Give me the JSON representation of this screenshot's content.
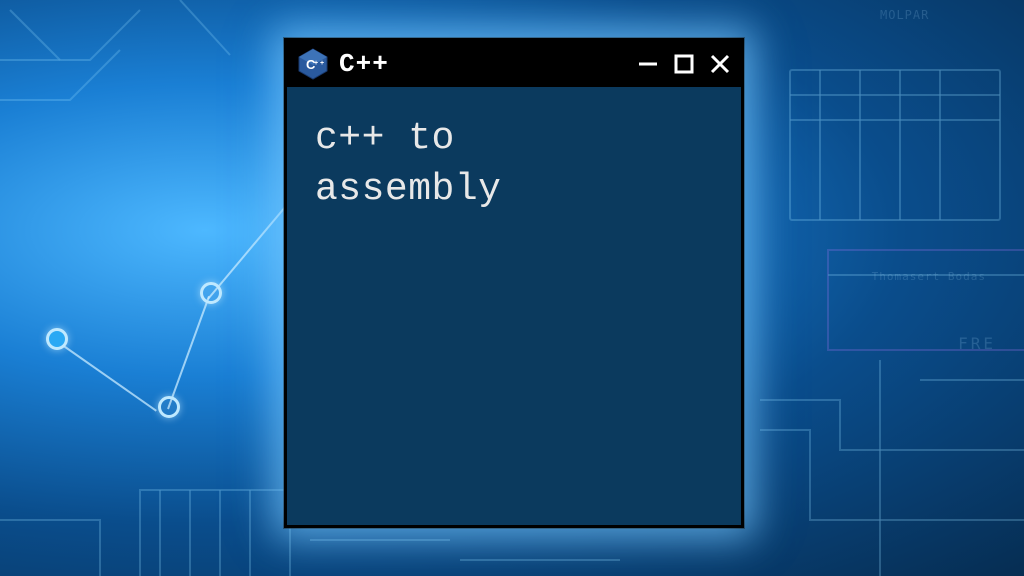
{
  "window": {
    "title": "C++",
    "body_line1": "c++ to",
    "body_line2": "assembly"
  },
  "icons": {
    "app": "cpp-hexagon-icon",
    "minimize": "minimize-icon",
    "maximize": "maximize-icon",
    "close": "close-icon"
  }
}
